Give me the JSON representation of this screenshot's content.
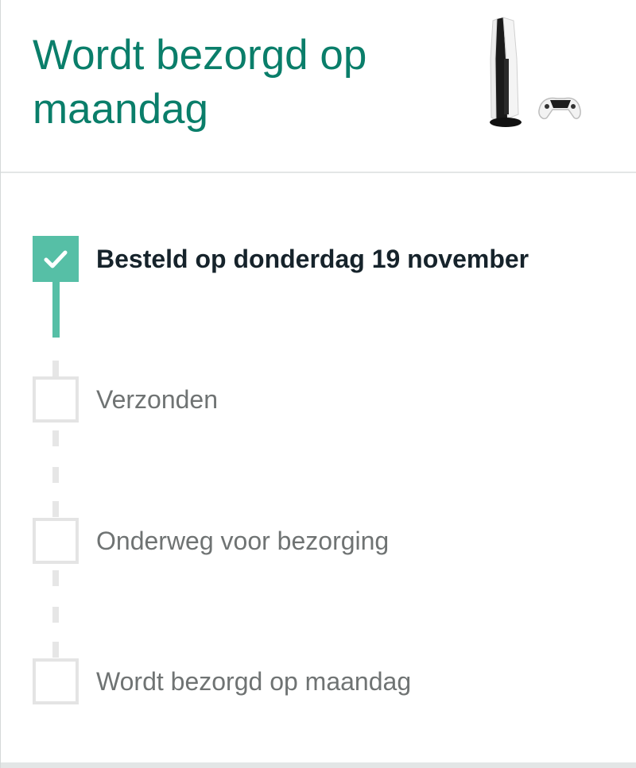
{
  "header": {
    "title": "Wordt bezorgd op maandag",
    "product_image": "ps5-console-with-controller"
  },
  "timeline": {
    "steps": [
      {
        "label": "Besteld op donderdag 19 november",
        "status": "done",
        "icon": "check-icon"
      },
      {
        "label": "Verzonden",
        "status": "pending"
      },
      {
        "label": "Onderweg voor bezorging",
        "status": "pending"
      },
      {
        "label": "Wordt bezorgd op maandag",
        "status": "pending"
      }
    ]
  },
  "colors": {
    "accent": "#0a7e6a",
    "done": "#56bfa6",
    "pending_border": "#e4e4e4",
    "pending_text": "#6f7373",
    "done_text": "#16232b"
  }
}
